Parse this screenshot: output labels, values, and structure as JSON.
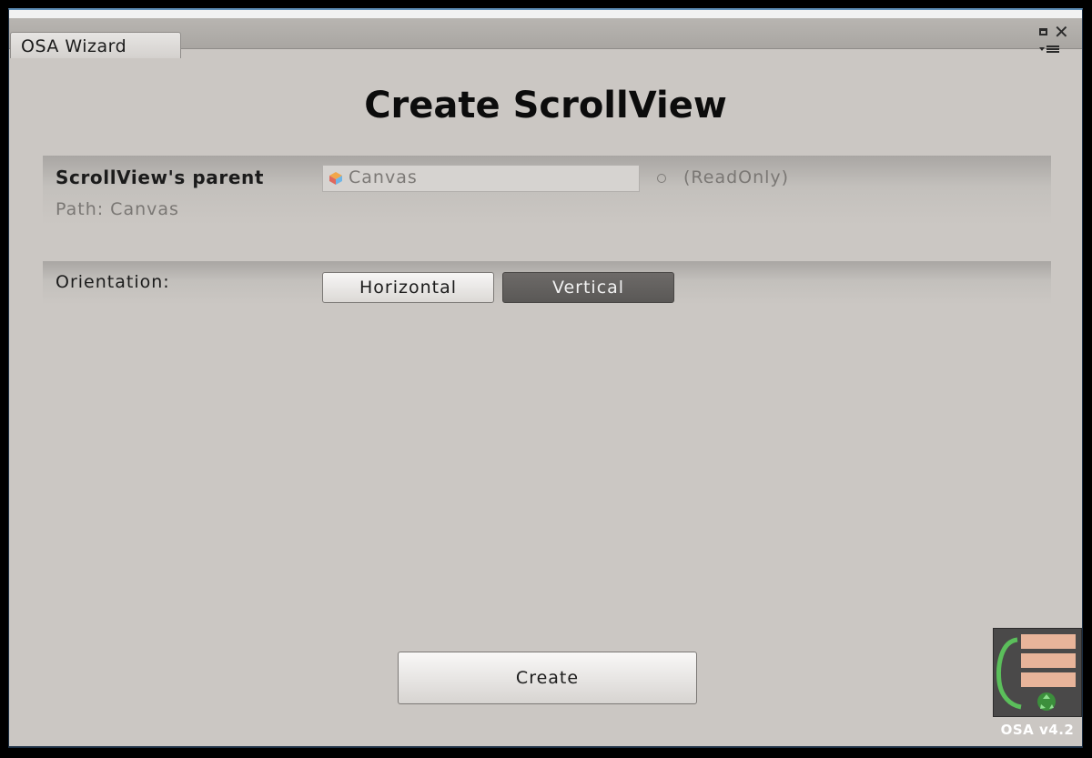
{
  "window": {
    "tab_title": "OSA Wizard",
    "page_title": "Create ScrollView"
  },
  "parent_section": {
    "label": "ScrollView's parent",
    "field_value": "Canvas",
    "readonly_note": "(ReadOnly)",
    "path": "Path: Canvas"
  },
  "orientation_section": {
    "label": "Orientation:",
    "options": [
      "Horizontal",
      "Vertical"
    ],
    "selected": "Vertical"
  },
  "actions": {
    "create_label": "Create"
  },
  "branding": {
    "logo_text": "OSA v4.2"
  },
  "icons": {
    "maximize": "maximize-icon",
    "close": "close-icon",
    "menu": "window-menu-icon",
    "object": "gameobject-icon",
    "picker": "object-picker-icon",
    "logo": "osa-logo-icon"
  },
  "colors": {
    "window_bg": "#cbc7c3",
    "selected_toggle": "#5f5d5b",
    "logo_accent": "#e8b49a",
    "logo_green": "#5bbf5b"
  }
}
